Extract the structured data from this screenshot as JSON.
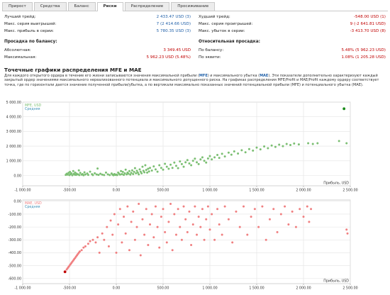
{
  "tabs": [
    {
      "label": "Прирост",
      "active": false
    },
    {
      "label": "Средства",
      "active": false
    },
    {
      "label": "Баланс",
      "active": false
    },
    {
      "label": "Риски",
      "active": true
    },
    {
      "label": "Распределение",
      "active": false
    },
    {
      "label": "Просиживание",
      "active": false
    }
  ],
  "left_stats": [
    {
      "label": "Лучший трейд:",
      "value": "2 433.47 USD (3)",
      "style": "link"
    },
    {
      "label": "Макс. серия выигрышей:",
      "value": "7 (2 414.66 USD)",
      "style": "link"
    },
    {
      "label": "Макс. прибыль в серии:",
      "value": "5 780.35 USD (3)",
      "style": "link"
    }
  ],
  "right_stats": [
    {
      "label": "Худший трейд:",
      "value": "-548.00 USD (1)",
      "style": "red"
    },
    {
      "label": "Макс. серия проигрышей:",
      "value": "9 (-2 641.81 USD)",
      "style": "red"
    },
    {
      "label": "Макс. убыток в серии:",
      "value": "-3 413.70 USD (8)",
      "style": "red"
    }
  ],
  "drawdown_balance": {
    "title": "Просадка по балансу:",
    "rows": [
      {
        "label": "Абсолютная:",
        "value": "3 349.45 USD"
      },
      {
        "label": "Максимальная:",
        "value": "5 962.23 USD (5.48%)"
      }
    ]
  },
  "drawdown_relative": {
    "title": "Относительная просадка:",
    "rows": [
      {
        "label": "По балансу:",
        "value": "5.48% (5 962.23 USD)"
      },
      {
        "label": "По эквити:",
        "value": "1.08% (1 205.28 USD)"
      }
    ]
  },
  "section_title": "Точечные графики распределения MFE и MAE",
  "description": {
    "p1": "Для каждого открытого ордера в течение его жизни записываются значения максимальной прибыли (",
    "mfe": "MFE",
    "p2": ") и максимального убытка (",
    "mae": "MAE",
    "p3": "). Эти показатели дополнительно характеризуют каждый закрытый ордер значениями максимального нереализованного потенциала и максимального допущенного риска. На графиках распределения MFE/Profit и MAE/Profit каждому ордеру соответствует точка, где по горизонтали дается значение полученной прибыли/убытка, а по вертикали максимально показанных значений потенциальной прибыли (MFE) и потенциального убытка (MAE)."
  },
  "chart_data": [
    {
      "type": "scatter",
      "title": "",
      "series_label": "MFE, USD",
      "avg_label": "Средняя",
      "xlabel": "Прибыль, USD",
      "ylabel": "",
      "xlim": [
        -1000,
        2500
      ],
      "ylim": [
        -700,
        5000
      ],
      "x_ticks": [
        "-1 000.00",
        "-500.00",
        "0.00",
        "500.00",
        "1 000.00",
        "1 500.00",
        "2 000.00",
        "2 500.00"
      ],
      "y_ticks": [
        "5 000.00",
        "4 000.00",
        "3 000.00",
        "2 000.00",
        "1 000.00",
        "0.00"
      ],
      "color": "#7cbf73",
      "highlight_color": "#1a8a1a",
      "highlight": [
        2433,
        4550
      ],
      "points": [
        [
          -540,
          40
        ],
        [
          -530,
          120
        ],
        [
          -520,
          60
        ],
        [
          -510,
          180
        ],
        [
          -500,
          30
        ],
        [
          -495,
          250
        ],
        [
          -490,
          90
        ],
        [
          -480,
          150
        ],
        [
          -470,
          20
        ],
        [
          -460,
          300
        ],
        [
          -455,
          110
        ],
        [
          -445,
          60
        ],
        [
          -440,
          200
        ],
        [
          -430,
          40
        ],
        [
          -425,
          130
        ],
        [
          -410,
          80
        ],
        [
          -400,
          350
        ],
        [
          -395,
          30
        ],
        [
          -385,
          180
        ],
        [
          -370,
          60
        ],
        [
          -360,
          100
        ],
        [
          -350,
          20
        ],
        [
          -340,
          220
        ],
        [
          -330,
          70
        ],
        [
          -310,
          140
        ],
        [
          -300,
          40
        ],
        [
          -280,
          260
        ],
        [
          -260,
          90
        ],
        [
          -250,
          30
        ],
        [
          -230,
          150
        ],
        [
          -210,
          70
        ],
        [
          -200,
          480
        ],
        [
          -190,
          40
        ],
        [
          -170,
          120
        ],
        [
          -150,
          60
        ],
        [
          -130,
          30
        ],
        [
          -110,
          200
        ],
        [
          -90,
          80
        ],
        [
          -70,
          30
        ],
        [
          -50,
          140
        ],
        [
          -40,
          60
        ],
        [
          -30,
          20
        ],
        [
          -20,
          100
        ],
        [
          -10,
          40
        ],
        [
          0,
          60
        ],
        [
          10,
          30
        ],
        [
          20,
          200
        ],
        [
          30,
          120
        ],
        [
          40,
          60
        ],
        [
          50,
          300
        ],
        [
          60,
          100
        ],
        [
          70,
          250
        ],
        [
          80,
          40
        ],
        [
          90,
          150
        ],
        [
          100,
          400
        ],
        [
          110,
          80
        ],
        [
          120,
          200
        ],
        [
          130,
          120
        ],
        [
          140,
          300
        ],
        [
          150,
          60
        ],
        [
          160,
          180
        ],
        [
          170,
          350
        ],
        [
          180,
          100
        ],
        [
          190,
          250
        ],
        [
          200,
          500
        ],
        [
          210,
          150
        ],
        [
          220,
          320
        ],
        [
          230,
          200
        ],
        [
          240,
          80
        ],
        [
          250,
          420
        ],
        [
          260,
          260
        ],
        [
          270,
          150
        ],
        [
          280,
          600
        ],
        [
          290,
          320
        ],
        [
          300,
          220
        ],
        [
          310,
          700
        ],
        [
          320,
          380
        ],
        [
          330,
          200
        ],
        [
          340,
          460
        ],
        [
          350,
          280
        ],
        [
          360,
          520
        ],
        [
          380,
          340
        ],
        [
          400,
          620
        ],
        [
          420,
          420
        ],
        [
          440,
          260
        ],
        [
          460,
          700
        ],
        [
          480,
          520
        ],
        [
          500,
          400
        ],
        [
          520,
          800
        ],
        [
          540,
          600
        ],
        [
          560,
          460
        ],
        [
          580,
          740
        ],
        [
          600,
          520
        ],
        [
          620,
          880
        ],
        [
          640,
          660
        ],
        [
          660,
          500
        ],
        [
          680,
          960
        ],
        [
          700,
          780
        ],
        [
          720,
          600
        ],
        [
          740,
          900
        ],
        [
          760,
          1050
        ],
        [
          780,
          820
        ],
        [
          800,
          700
        ],
        [
          820,
          1000
        ],
        [
          840,
          1150
        ],
        [
          860,
          900
        ],
        [
          880,
          780
        ],
        [
          900,
          1100
        ],
        [
          920,
          1240
        ],
        [
          940,
          1000
        ],
        [
          960,
          880
        ],
        [
          980,
          1160
        ],
        [
          1000,
          1320
        ],
        [
          1020,
          1100
        ],
        [
          1050,
          1240
        ],
        [
          1080,
          1400
        ],
        [
          1100,
          1200
        ],
        [
          1130,
          1480
        ],
        [
          1160,
          1300
        ],
        [
          1200,
          1560
        ],
        [
          1230,
          1420
        ],
        [
          1260,
          1640
        ],
        [
          1300,
          1500
        ],
        [
          1340,
          1720
        ],
        [
          1380,
          1580
        ],
        [
          1420,
          1800
        ],
        [
          1460,
          1700
        ],
        [
          1500,
          1900
        ],
        [
          1540,
          1780
        ],
        [
          1580,
          1980
        ],
        [
          1620,
          1860
        ],
        [
          1660,
          2040
        ],
        [
          1700,
          1950
        ],
        [
          1740,
          2100
        ],
        [
          1780,
          2000
        ],
        [
          1820,
          2150
        ],
        [
          1860,
          2080
        ],
        [
          1900,
          2180
        ],
        [
          1950,
          2120
        ],
        [
          2050,
          2200
        ],
        [
          2100,
          2150
        ],
        [
          2150,
          2200
        ],
        [
          2380,
          2350
        ],
        [
          2460,
          2200
        ]
      ]
    },
    {
      "type": "scatter",
      "title": "",
      "series_label": "MAE, USD",
      "avg_label": "Средняя",
      "xlabel": "Прибыль, USD",
      "ylabel": "",
      "xlim": [
        -1000,
        2500
      ],
      "ylim": [
        -640,
        10
      ],
      "x_ticks": [
        "-1 000.00",
        "-500.00",
        "0.00",
        "500.00",
        "1 000.00",
        "1 500.00",
        "2 000.00",
        "2 500.00"
      ],
      "y_ticks": [
        "0.00",
        "-100.00",
        "-200.00",
        "-300.00",
        "-400.00",
        "-500.00",
        "-600.00"
      ],
      "color": "#f07f80",
      "highlight_color": "#c00000",
      "highlight": [
        -548,
        -548
      ],
      "points": [
        [
          -530,
          -530
        ],
        [
          -520,
          -520
        ],
        [
          -510,
          -510
        ],
        [
          -500,
          -500
        ],
        [
          -490,
          -490
        ],
        [
          -480,
          -480
        ],
        [
          -470,
          -470
        ],
        [
          -460,
          -460
        ],
        [
          -450,
          -450
        ],
        [
          -440,
          -440
        ],
        [
          -430,
          -430
        ],
        [
          -420,
          -420
        ],
        [
          -410,
          -410
        ],
        [
          -400,
          -400
        ],
        [
          -390,
          -390
        ],
        [
          -370,
          -380
        ],
        [
          -350,
          -360
        ],
        [
          -330,
          -350
        ],
        [
          -300,
          -330
        ],
        [
          -280,
          -310
        ],
        [
          -250,
          -300
        ],
        [
          -220,
          -320
        ],
        [
          -200,
          -280
        ],
        [
          -180,
          -400
        ],
        [
          -150,
          -250
        ],
        [
          -130,
          -300
        ],
        [
          -100,
          -200
        ],
        [
          -80,
          -350
        ],
        [
          -60,
          -150
        ],
        [
          -40,
          -260
        ],
        [
          -20,
          -100
        ],
        [
          0,
          -400
        ],
        [
          20,
          -180
        ],
        [
          40,
          -60
        ],
        [
          60,
          -320
        ],
        [
          80,
          -120
        ],
        [
          100,
          -250
        ],
        [
          120,
          -40
        ],
        [
          140,
          -380
        ],
        [
          160,
          -160
        ],
        [
          180,
          -80
        ],
        [
          200,
          -300
        ],
        [
          220,
          -200
        ],
        [
          240,
          -20
        ],
        [
          260,
          -420
        ],
        [
          280,
          -140
        ],
        [
          300,
          -260
        ],
        [
          320,
          -60
        ],
        [
          340,
          -340
        ],
        [
          360,
          -180
        ],
        [
          380,
          -100
        ],
        [
          400,
          -280
        ],
        [
          420,
          -40
        ],
        [
          440,
          -200
        ],
        [
          460,
          -360
        ],
        [
          480,
          -120
        ],
        [
          500,
          -60
        ],
        [
          520,
          -240
        ],
        [
          540,
          -320
        ],
        [
          560,
          -160
        ],
        [
          580,
          -20
        ],
        [
          600,
          -380
        ],
        [
          620,
          -100
        ],
        [
          640,
          -260
        ],
        [
          660,
          -60
        ],
        [
          680,
          -200
        ],
        [
          700,
          -300
        ],
        [
          720,
          -40
        ],
        [
          740,
          -140
        ],
        [
          760,
          -240
        ],
        [
          780,
          -80
        ],
        [
          800,
          -340
        ],
        [
          820,
          -180
        ],
        [
          840,
          -40
        ],
        [
          860,
          -260
        ],
        [
          880,
          -120
        ],
        [
          900,
          -200
        ],
        [
          920,
          -60
        ],
        [
          940,
          -300
        ],
        [
          960,
          -140
        ],
        [
          980,
          -40
        ],
        [
          1000,
          -220
        ],
        [
          1020,
          -100
        ],
        [
          1050,
          -300
        ],
        [
          1080,
          -60
        ],
        [
          1100,
          -180
        ],
        [
          1130,
          -260
        ],
        [
          1160,
          -40
        ],
        [
          1200,
          -140
        ],
        [
          1240,
          -320
        ],
        [
          1280,
          -80
        ],
        [
          1320,
          -200
        ],
        [
          1360,
          -40
        ],
        [
          1400,
          -260
        ],
        [
          1440,
          -120
        ],
        [
          1480,
          -60
        ],
        [
          1520,
          -200
        ],
        [
          1560,
          -40
        ],
        [
          1600,
          -300
        ],
        [
          1640,
          -140
        ],
        [
          1680,
          -60
        ],
        [
          1720,
          -240
        ],
        [
          1760,
          -100
        ],
        [
          1800,
          -40
        ],
        [
          1840,
          -180
        ],
        [
          1880,
          -80
        ],
        [
          1920,
          -200
        ],
        [
          1960,
          -60
        ],
        [
          2000,
          -120
        ],
        [
          2040,
          -40
        ],
        [
          2060,
          -160
        ],
        [
          2080,
          -60
        ],
        [
          2460,
          -220
        ],
        [
          2470,
          -250
        ]
      ]
    }
  ]
}
